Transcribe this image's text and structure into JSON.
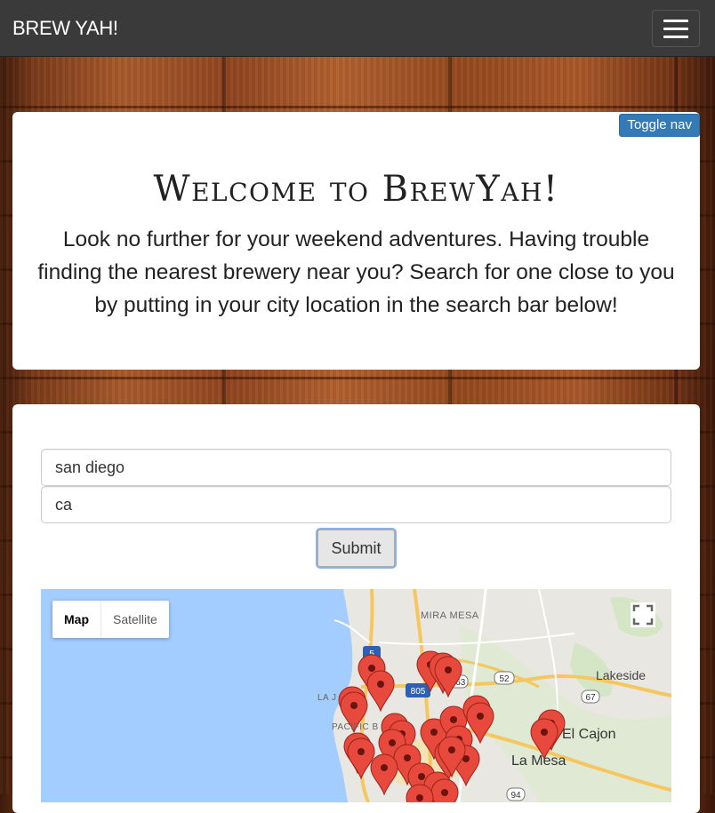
{
  "navbar": {
    "brand": "BREW YAH!",
    "menu_icon": "hamburger-icon"
  },
  "welcome": {
    "toggle_label": "Toggle nav",
    "title": "Welcome to BrewYah!",
    "description": "Look no further for your weekend adventures. Having trouble finding the nearest brewery near you? Search for one close to you by putting in your city location in the search bar below!"
  },
  "search": {
    "city_value": "san diego",
    "state_value": "ca",
    "submit_label": "Submit"
  },
  "map": {
    "type_map": "Map",
    "type_satellite": "Satellite",
    "fullscreen_icon": "fullscreen-icon",
    "labels": {
      "mira_mesa": "MIRA MESA",
      "lakeside": "Lakeside",
      "el_cajon": "El Cajon",
      "la_mesa": "La Mesa",
      "la_jolla": "LA J",
      "pacific_beach": "PACIFIC B"
    },
    "shields": {
      "i5": "5",
      "i805": "805",
      "r163": "163",
      "r52": "52",
      "r67": "67",
      "r94": "94"
    },
    "marker_color": "#e8493d",
    "water_color": "#a3ccff"
  }
}
